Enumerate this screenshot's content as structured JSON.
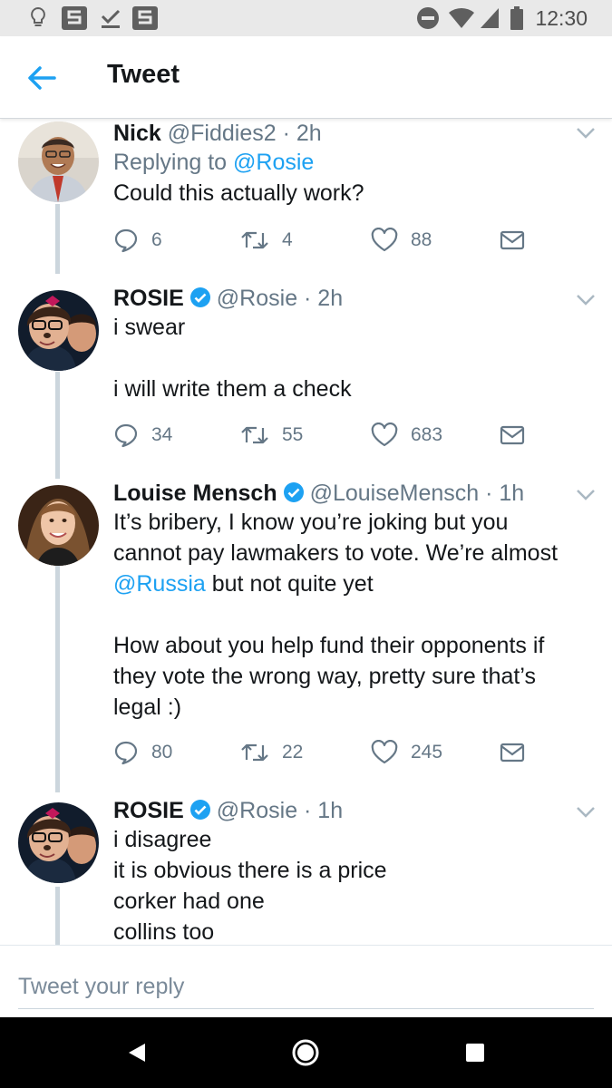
{
  "status_bar": {
    "time": "12:30"
  },
  "app_bar": {
    "title": "Tweet"
  },
  "tweets": [
    {
      "name": "Nick",
      "handle": "@Fiddies2 · 2h",
      "reply_prefix": "Replying to ",
      "reply_to": "@Rosie",
      "text": "Could this actually work?",
      "replies": "6",
      "retweets": "4",
      "likes": "88",
      "verified": false
    },
    {
      "name": "ROSIE",
      "handle": "@Rosie · 2h",
      "text": "i swear\n\ni will write them a check",
      "replies": "34",
      "retweets": "55",
      "likes": "683",
      "verified": true
    },
    {
      "name": "Louise Mensch",
      "handle": "@LouiseMensch · 1h",
      "text_1": "It’s bribery, I know you’re joking but you cannot pay lawmakers to vote. We’re almost",
      "mention": "@Russia",
      "text_2": " but not quite yet\n\nHow about you help fund their opponents if they vote the wrong way, pretty sure that’s legal :)",
      "replies": "80",
      "retweets": "22",
      "likes": "245",
      "verified": true
    },
    {
      "name": "ROSIE",
      "handle": "@Rosie · 1h",
      "text": "i disagree\nit is obvious there is a price\ncorker had one\ncollins too",
      "verified": true
    }
  ],
  "reply_bar": {
    "placeholder": "Tweet your reply"
  },
  "colors": {
    "accent": "#1da1f2",
    "secondary_text": "#657786",
    "thread_line": "#ccd6dd"
  }
}
